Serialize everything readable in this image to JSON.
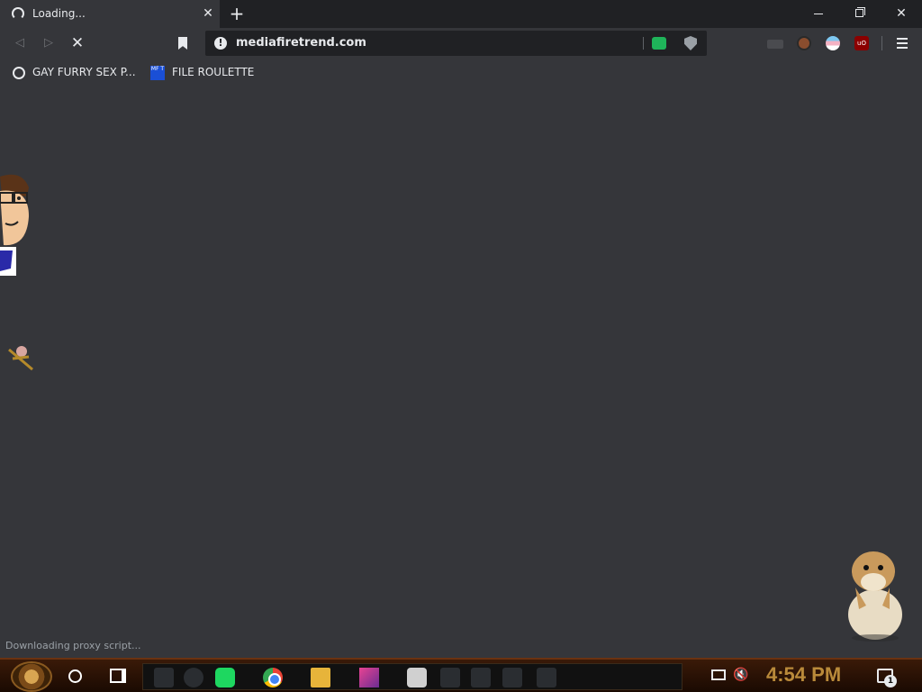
{
  "browser": {
    "tab": {
      "title": "Loading...",
      "loading_icon": "spinner-icon"
    },
    "window_controls": [
      "minimize",
      "restore",
      "close"
    ],
    "toolbar": {
      "url": "mediafiretrend.com",
      "security_icon": "info-icon"
    },
    "bookmarks": [
      {
        "label": "GAY FURRY SEX P...",
        "icon": "globe-icon"
      },
      {
        "label": "FILE ROULETTE",
        "icon": "mft-icon",
        "icon_text": "MF T"
      }
    ],
    "status_text": "Downloading proxy script..."
  },
  "taskbar": {
    "clock": "4:54 PM",
    "notification_count": "1",
    "pinned_apps": [
      "spotify",
      "chrome",
      "file-explorer",
      "app",
      "skull-app"
    ]
  },
  "colors": {
    "chrome_dark": "#202124",
    "chrome_bg": "#35363a",
    "clock": "#b98a3a",
    "spotify": "#1ed760"
  }
}
